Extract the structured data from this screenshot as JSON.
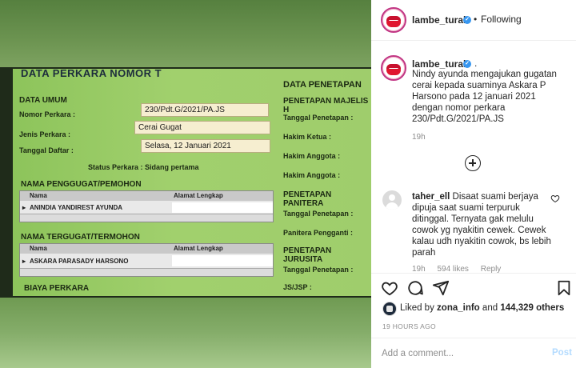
{
  "photo": {
    "title": "DATA PERKARA NOMOR T",
    "data_umum": {
      "heading": "DATA UMUM",
      "nomor_label": "Nomor Perkara :",
      "nomor_value": "230/Pdt.G/2021/PA.JS",
      "jenis_label": "Jenis Perkara :",
      "jenis_value": "Cerai Gugat",
      "tanggal_label": "Tanggal Daftar :",
      "tanggal_value": "Selasa, 12 Januari 2021",
      "status": "Status Perkara : Sidang pertama"
    },
    "penggugat": {
      "heading": "NAMA PENGGUGAT/PEMOHON",
      "col_nama": "Nama",
      "col_alamat": "Alamat Lengkap",
      "row_name": "ANINDIA YANDIREST AYUNDA"
    },
    "tergugat": {
      "heading": "NAMA TERGUGAT/TERMOHON",
      "col_nama": "Nama",
      "col_alamat": "Alamat Lengkap",
      "row_name": "ASKARA PARASADY HARSONO"
    },
    "biaya": "BIAYA PERKARA",
    "penetapan": {
      "heading": "DATA PENETAPAN",
      "majelis": "PENETAPAN MAJELIS H",
      "tanggal1": "Tanggal Penetapan :",
      "hakim_ketua": "Hakim Ketua :",
      "hakim_anggota1": "Hakim Anggota :",
      "hakim_anggota2": "Hakim Anggota :",
      "panitera": "PENETAPAN PANITERA",
      "tanggal2": "Tanggal Penetapan :",
      "panitera_pengganti": "Panitera Pengganti :",
      "jurusita": "PENETAPAN JURUSITA",
      "tanggal3": "Tanggal Penetapan :",
      "jsjsp": "JS/JSP :"
    }
  },
  "header": {
    "username": "lambe_turah",
    "follow_label": "Following",
    "dot": "•"
  },
  "caption": {
    "username": "lambe_turah",
    "dot": ".",
    "text": "Nindy ayunda mengajukan gugatan cerai kepada suaminya Askara P Harsono pada 12 januari 2021 dengan nomor perkara 230/Pdt.G/2021/PA.JS",
    "time": "19h"
  },
  "comment": {
    "username": "taher_ell",
    "text": "Disaat suami berjaya dipuja saat suami terpuruk ditinggal. Ternyata gak melulu cowok yg nyakitin cewek. Cewek kalau udh nyakitin cowok, bs lebih parah",
    "time": "19h",
    "likes": "594 likes",
    "reply": "Reply"
  },
  "likes": {
    "prefix": "Liked by",
    "user": "zona_info",
    "middle": "and",
    "count": "144,329 others"
  },
  "post_time": "19 HOURS AGO",
  "add_comment": {
    "placeholder": "Add a comment...",
    "post_label": "Post"
  },
  "icons": [
    "heart-icon",
    "comment-icon",
    "share-icon",
    "bookmark-icon",
    "add-circle-icon",
    "verified-icon"
  ],
  "colors": {
    "verified": "#3897f0",
    "post_disabled": "#b3dbff",
    "screen_green": "#9fcd6c"
  }
}
